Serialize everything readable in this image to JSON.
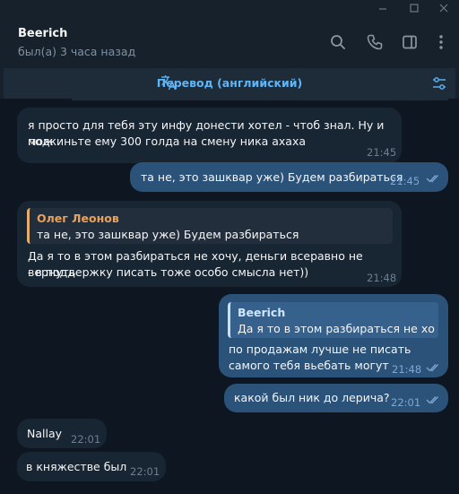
{
  "header": {
    "name": "Beerich",
    "status": "был(а) 3 часа назад"
  },
  "translation_bar": {
    "label": "Перевод (английский)"
  },
  "messages": [
    {
      "direction": "in",
      "text1": "я просто для тебя эту инфу донести хотел - чтоб знал. Ну и мож",
      "text2": "подкиньте ему 300 голда на смену ника ахаха",
      "time": "21:45"
    },
    {
      "direction": "out",
      "text1": "та не, это зашквар уже) Будем разбираться",
      "time": "21:45"
    },
    {
      "direction": "in",
      "reply_name": "Олег Леонов",
      "reply_text": "та не, это зашквар уже) Будем разбираться",
      "text1": "Да я то в этом разбираться не хочу, деньги всеравно не вернуть",
      "text2": "- в поддержку писать тоже особо смысла нет))",
      "time": "21:48"
    },
    {
      "direction": "out",
      "reply_name": "Beerich",
      "reply_text": "Да я то в этом разбираться не хо...",
      "text1": "по продажам лучше не писать",
      "text2": "самого тебя вьебать могут",
      "time": "21:48"
    },
    {
      "direction": "out",
      "text1": "какой был ник до лерича?",
      "time": "22:01"
    },
    {
      "direction": "in",
      "text1": "Nallay",
      "time": "22:01"
    },
    {
      "direction": "in",
      "text1": "в княжестве был",
      "time": "22:01"
    }
  ],
  "icons": [
    "minimize-icon",
    "maximize-icon",
    "close-icon",
    "search-icon",
    "phone-icon",
    "sidebar-toggle-icon",
    "more-icon",
    "translate-icon",
    "filter-settings-icon",
    "double-check-icon"
  ],
  "colors": {
    "accent": "#5eb5f7",
    "outgoing": "#2b5278",
    "incoming": "#182533",
    "background": "#0e1621",
    "reply_name": "#e9a25c"
  }
}
